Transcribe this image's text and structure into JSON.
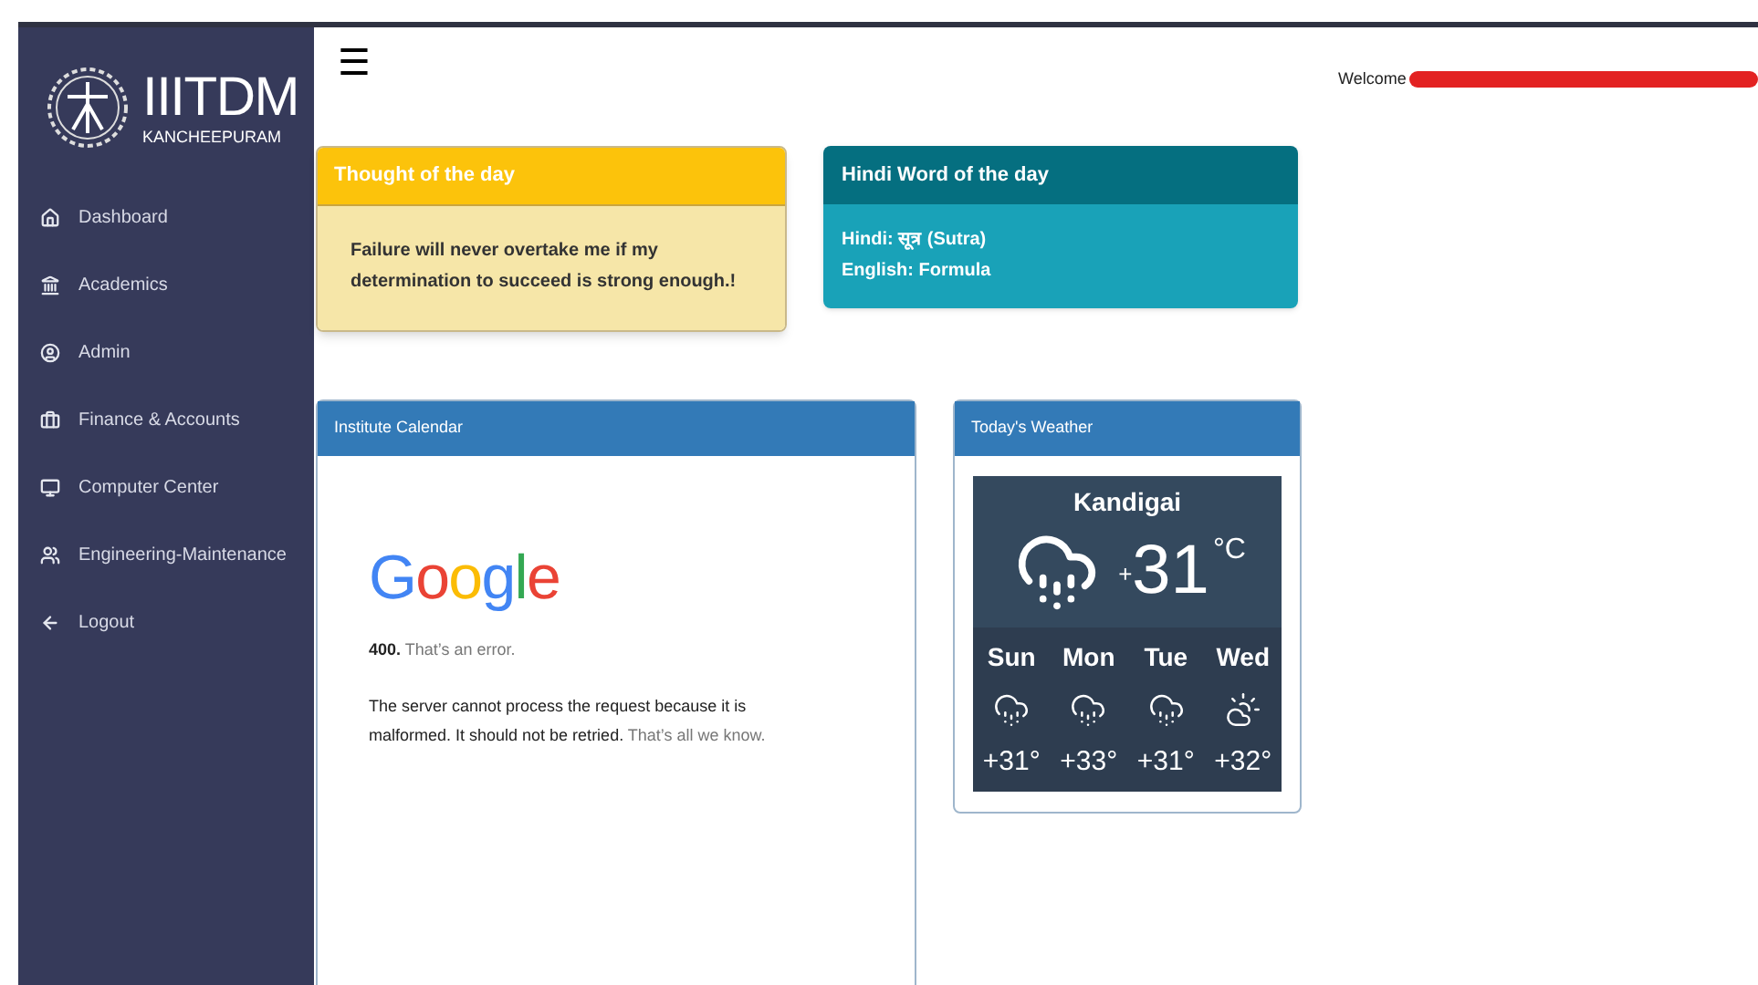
{
  "sidebar": {
    "logo": {
      "title": "IIITDM",
      "subtitle": "KANCHEEPURAM"
    },
    "items": [
      {
        "kind": "home",
        "label": "Dashboard"
      },
      {
        "kind": "bank",
        "label": "Academics"
      },
      {
        "kind": "user",
        "label": "Admin"
      },
      {
        "kind": "briefcase",
        "label": "Finance & Accounts"
      },
      {
        "kind": "monitor",
        "label": "Computer Center"
      },
      {
        "kind": "users",
        "label": "Engineering-Maintenance"
      },
      {
        "kind": "logout",
        "label": "Logout"
      }
    ]
  },
  "header": {
    "menu_icon": "☰",
    "welcome": "Welcome",
    "name_redacted": true
  },
  "thought": {
    "title": "Thought of the day",
    "text": "Failure will never overtake me if my determination to succeed is strong enough.!"
  },
  "hindi_word": {
    "title": "Hindi Word of the day",
    "lines": [
      "Hindi: सूत्र (Sutra)",
      "English: Formula"
    ]
  },
  "calendar": {
    "title": "Institute Calendar",
    "error": {
      "logo": "Google",
      "code": "400.",
      "message": "That’s an error.",
      "text": "The server cannot process the request because it is malformed. It should not be retried.",
      "text_muted": "That’s all we know."
    }
  },
  "weather": {
    "title": "Today's Weather",
    "city": "Kandigai",
    "sign": "+",
    "temp": "31",
    "unit": "°C",
    "days": [
      {
        "day": "Sun",
        "kind": "rain",
        "temp": "+31°"
      },
      {
        "day": "Mon",
        "kind": "rain",
        "temp": "+33°"
      },
      {
        "day": "Tue",
        "kind": "rain",
        "temp": "+31°"
      },
      {
        "day": "Wed",
        "kind": "partly-cloudy",
        "temp": "+32°"
      }
    ]
  }
}
